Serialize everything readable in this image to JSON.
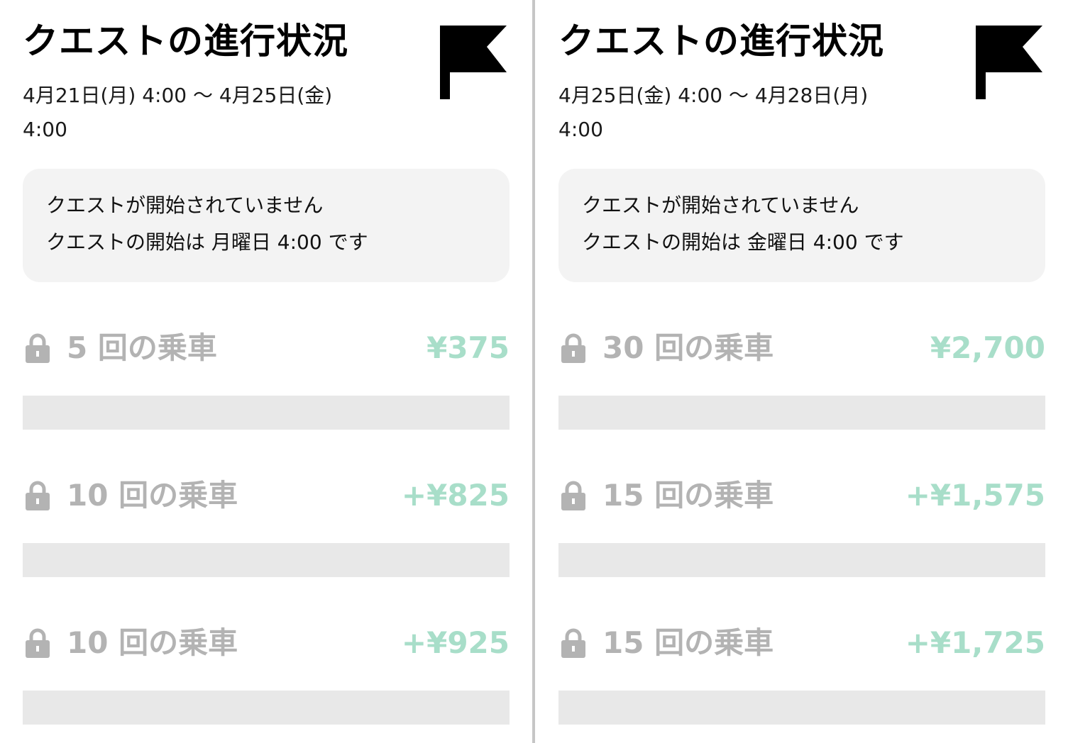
{
  "panels": [
    {
      "title": "クエストの進行状況",
      "date_range": "4月21日(月) 4:00 〜 4月25日(金) 4:00",
      "notice_title": "クエストが開始されていません",
      "notice_sub": "クエストの開始は 月曜日 4:00 です",
      "tiers": [
        {
          "label": "5 回の乗車",
          "reward": "¥375",
          "progress": 0
        },
        {
          "label": "10 回の乗車",
          "reward": "+¥825",
          "progress": 0
        },
        {
          "label": "10 回の乗車",
          "reward": "+¥925",
          "progress": 0
        }
      ]
    },
    {
      "title": "クエストの進行状況",
      "date_range": "4月25日(金) 4:00 〜 4月28日(月) 4:00",
      "notice_title": "クエストが開始されていません",
      "notice_sub": "クエストの開始は 金曜日 4:00 です",
      "tiers": [
        {
          "label": "30 回の乗車",
          "reward": "¥2,700",
          "progress": 0
        },
        {
          "label": "15 回の乗車",
          "reward": "+¥1,575",
          "progress": 0
        },
        {
          "label": "15 回の乗車",
          "reward": "+¥1,725",
          "progress": 0
        }
      ]
    }
  ],
  "icons": {
    "flag": "flag-icon",
    "lock": "lock-icon"
  },
  "colors": {
    "reward": "#a8dec9",
    "locked_text": "#b3b3b3",
    "bar_track": "#e8e8e8",
    "notice_bg": "#f3f3f3"
  }
}
